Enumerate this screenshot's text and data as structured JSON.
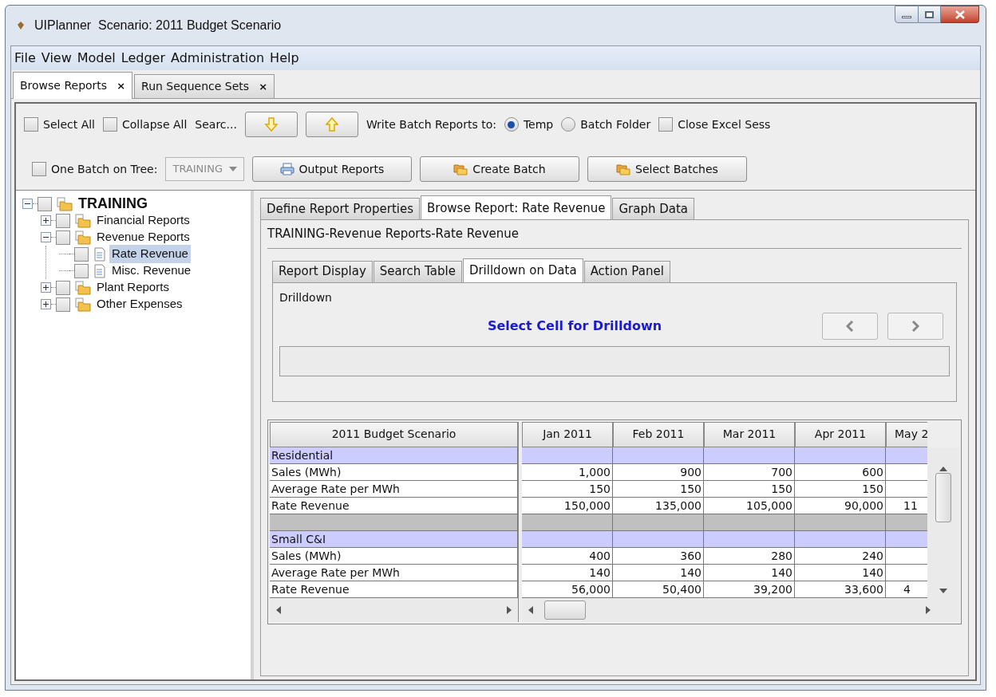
{
  "window": {
    "title": "UIPlanner  Scenario: 2011 Budget Scenario"
  },
  "menu": [
    "File",
    "View",
    "Model",
    "Ledger",
    "Administration",
    "Help"
  ],
  "tabs": [
    {
      "label": "Browse Reports",
      "close": "×",
      "selected": true
    },
    {
      "label": "Run Sequence Sets",
      "close": "×",
      "selected": false
    }
  ],
  "toolbar_rows": [
    [
      {
        "kind": "checkbox",
        "label": "Select All",
        "checked": false
      },
      {
        "kind": "checkbox",
        "label": "Collapse All",
        "checked": false
      },
      {
        "kind": "label",
        "text": "Searc..."
      },
      {
        "kind": "down_button"
      },
      {
        "kind": "up_button"
      },
      {
        "kind": "label",
        "text": "Write Batch Reports to:"
      },
      {
        "kind": "radio",
        "label": "Temp",
        "selected": true
      },
      {
        "kind": "radio",
        "label": "Batch Folder",
        "selected": false
      },
      {
        "kind": "checkbox",
        "label": "Close Excel Sess",
        "checked": false
      }
    ],
    [
      {
        "kind": "checkbox",
        "label": "One Batch on Tree:",
        "checked": false
      },
      {
        "kind": "dropdown",
        "value": "TRAINING",
        "disabled": true
      },
      {
        "kind": "print_button",
        "label": "Output Reports"
      },
      {
        "kind": "batch_button",
        "label": "Create Batch"
      },
      {
        "kind": "batch_button",
        "label": "Select Batches"
      }
    ]
  ],
  "tree": {
    "label": "TRAINING",
    "checked": false,
    "expanded": true,
    "selected": false,
    "children": [
      {
        "label": "Financial Reports",
        "checked": false,
        "expanded": false,
        "selected": false
      },
      {
        "label": "Revenue Reports",
        "checked": false,
        "expanded": true,
        "selected": false,
        "children": [
          {
            "label": "Rate Revenue",
            "checked": false,
            "selected": true,
            "kind": "report"
          },
          {
            "label": "Misc. Revenue",
            "checked": false,
            "selected": false,
            "kind": "report"
          }
        ]
      },
      {
        "label": "Plant Reports",
        "checked": false,
        "expanded": false,
        "selected": false
      },
      {
        "label": "Other Expenses",
        "checked": false,
        "expanded": false,
        "selected": false
      }
    ]
  },
  "report_tabs": [
    {
      "label": "Define Report Properties",
      "selected": false
    },
    {
      "label": "Browse Report: Rate Revenue",
      "selected": true
    },
    {
      "label": "Graph Data",
      "selected": false
    }
  ],
  "breadcrumb": "TRAINING-Revenue Reports-Rate Revenue",
  "sub_tabs": [
    {
      "label": "Report Display",
      "selected": false
    },
    {
      "label": "Search Table",
      "selected": false
    },
    {
      "label": "Drilldown on Data",
      "selected": true
    },
    {
      "label": "Action Panel",
      "selected": false
    }
  ],
  "drilldown": {
    "group_title": "Drilldown",
    "message": "Select Cell for Drilldown"
  },
  "table": {
    "row_header": "2011 Budget Scenario",
    "columns": [
      "Jan 2011",
      "Feb 2011",
      "Mar 2011",
      "Apr 2011",
      "May 2"
    ],
    "rows": [
      {
        "kind": "section",
        "label": "Residential"
      },
      {
        "kind": "data",
        "label": "Sales (MWh)",
        "values": [
          "1,000",
          "900",
          "700",
          "600"
        ]
      },
      {
        "kind": "data",
        "label": "Average Rate per MWh",
        "values": [
          "150",
          "150",
          "150",
          "150"
        ]
      },
      {
        "kind": "data",
        "label": "Rate Revenue",
        "values": [
          "150,000",
          "135,000",
          "105,000",
          "90,000",
          "11"
        ]
      },
      {
        "kind": "spacer"
      },
      {
        "kind": "section",
        "label": "Small C&I"
      },
      {
        "kind": "data",
        "label": "Sales (MWh)",
        "values": [
          "400",
          "360",
          "280",
          "240"
        ]
      },
      {
        "kind": "data",
        "label": "Average Rate per MWh",
        "values": [
          "140",
          "140",
          "140",
          "140"
        ]
      },
      {
        "kind": "data",
        "label": "Rate Revenue",
        "values": [
          "56,000",
          "50,400",
          "39,200",
          "33,600",
          "4"
        ]
      }
    ]
  }
}
